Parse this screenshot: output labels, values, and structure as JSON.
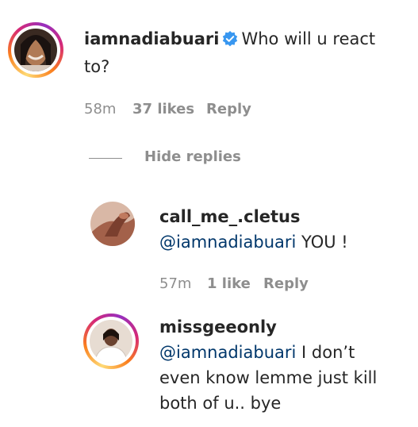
{
  "colors": {
    "text": "#262626",
    "muted": "#8e8e8e",
    "mention": "#00376b",
    "verified": "#3897f0"
  },
  "comment": {
    "username": "iamnadiabuari",
    "verified": true,
    "text_line1": "Who will u react",
    "text_line2": "to?",
    "time": "58m",
    "likes": "37 likes",
    "reply": "Reply"
  },
  "hide_replies": "Hide replies",
  "replies": [
    {
      "username": "call_me_.cletus",
      "mention": "@iamnadiabuari",
      "text": " YOU !",
      "time": "57m",
      "likes": "1 like",
      "reply": "Reply"
    },
    {
      "username": "missgeeonly",
      "mention": "@iamnadiabuari",
      "text_line1": " I don’t",
      "text_line2": "even know lemme just kill",
      "text_line3": "both of u.. bye"
    }
  ]
}
